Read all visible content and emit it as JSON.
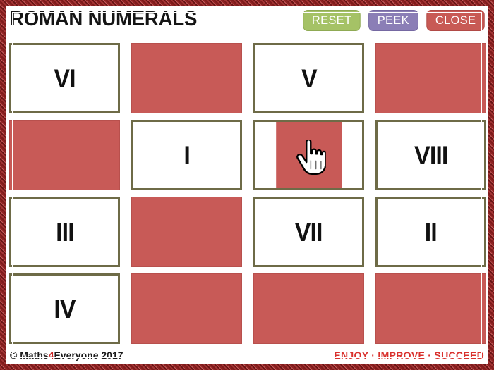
{
  "header": {
    "title": "ROMAN NUMERALS",
    "buttons": [
      {
        "label": "RESET",
        "name": "reset-button",
        "color": "#a5c266"
      },
      {
        "label": "PEEK",
        "name": "peek-button",
        "color": "#8b7eb6"
      },
      {
        "label": "CLOSE",
        "name": "close-button",
        "color": "#c85a55"
      }
    ]
  },
  "grid": {
    "rows": 4,
    "columns": 4,
    "card_back_color": "#c85a57",
    "card_border_color": "#6e6b47",
    "cells": [
      {
        "state": "face-up",
        "label": "VI"
      },
      {
        "state": "face-down",
        "label": ""
      },
      {
        "state": "face-up",
        "label": "V"
      },
      {
        "state": "face-down",
        "label": ""
      },
      {
        "state": "face-down",
        "label": ""
      },
      {
        "state": "face-up",
        "label": "I"
      },
      {
        "state": "flipping",
        "label": ""
      },
      {
        "state": "face-up",
        "label": "VIII"
      },
      {
        "state": "face-up",
        "label": "III"
      },
      {
        "state": "face-down",
        "label": ""
      },
      {
        "state": "face-up",
        "label": "VII"
      },
      {
        "state": "face-up",
        "label": "II"
      },
      {
        "state": "face-up",
        "label": "IV"
      },
      {
        "state": "face-down",
        "label": ""
      },
      {
        "state": "face-down",
        "label": ""
      },
      {
        "state": "face-down",
        "label": ""
      }
    ]
  },
  "cursor": {
    "icon": "pointing-hand-cursor",
    "cell_index": 6
  },
  "footer": {
    "copyright_prefix": "© Maths",
    "copyright_highlight": "4",
    "copyright_suffix": "Everyone 2017",
    "tagline": "ENJOY · IMPROVE · SUCCEED",
    "tagline_color": "#d9302c"
  },
  "frame": {
    "color": "#8e2222"
  }
}
